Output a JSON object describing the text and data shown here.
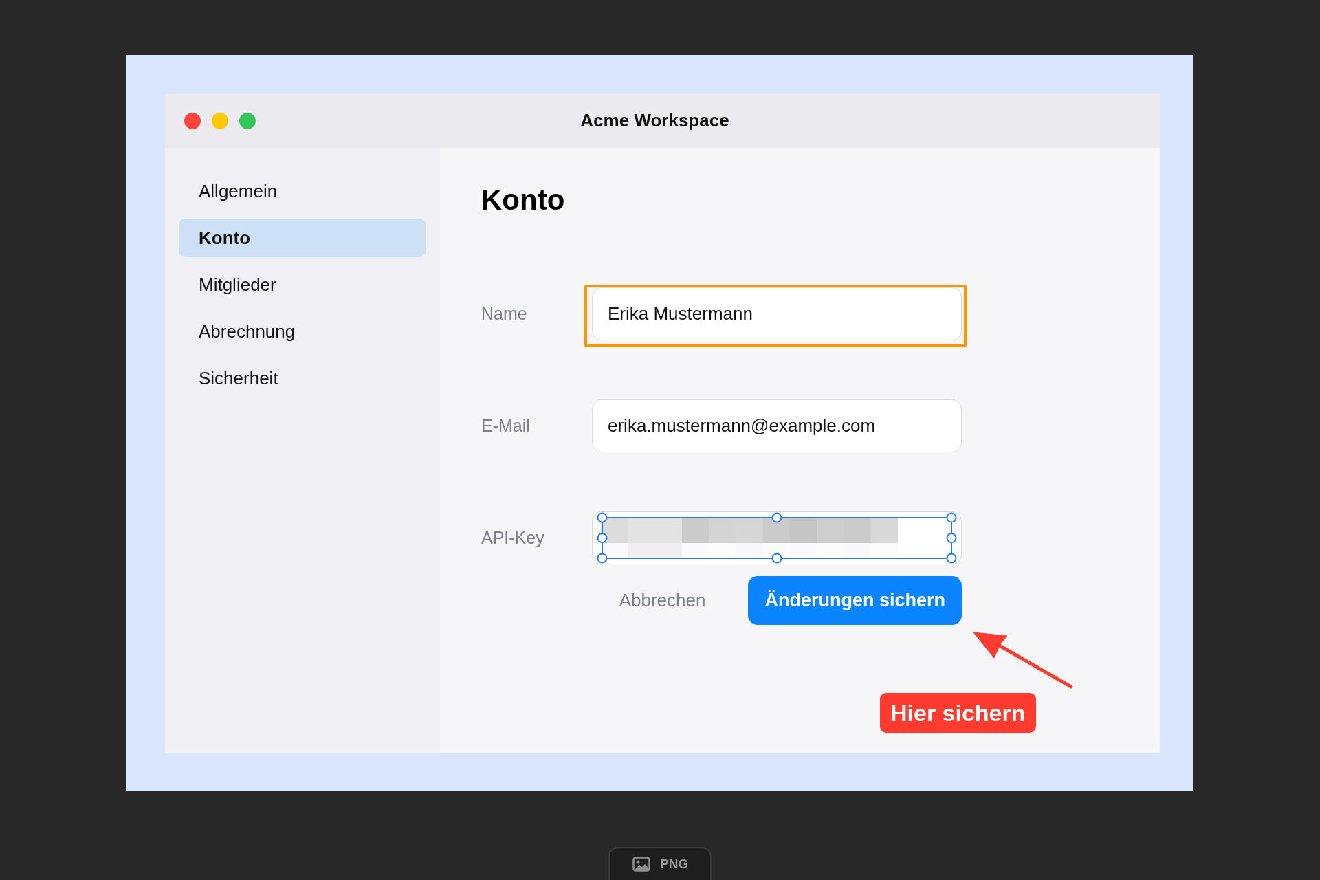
{
  "window": {
    "title": "Acme Workspace"
  },
  "sidebar": {
    "items": [
      {
        "label": "Allgemein",
        "selected": false
      },
      {
        "label": "Konto",
        "selected": true
      },
      {
        "label": "Mitglieder",
        "selected": false
      },
      {
        "label": "Abrechnung",
        "selected": false
      },
      {
        "label": "Sicherheit",
        "selected": false
      }
    ]
  },
  "content": {
    "heading": "Konto",
    "fields": [
      {
        "label": "Name",
        "value": "Erika Mustermann",
        "highlighted": true
      },
      {
        "label": "E-Mail",
        "value": "erika.mustermann@example.com",
        "highlighted": false
      },
      {
        "label": "API-Key",
        "highlighted": false,
        "redaction": {
          "selected": true
        }
      }
    ],
    "buttons": [
      {
        "label": "Abbrechen",
        "kind": "secondary"
      },
      {
        "label": "Änderungen sichern",
        "kind": "primary"
      }
    ]
  },
  "annotations": [
    {
      "kind": "arrow"
    },
    {
      "kind": "label",
      "text": "Hier sichern"
    }
  ],
  "viewer": {
    "format_badge": "PNG"
  }
}
